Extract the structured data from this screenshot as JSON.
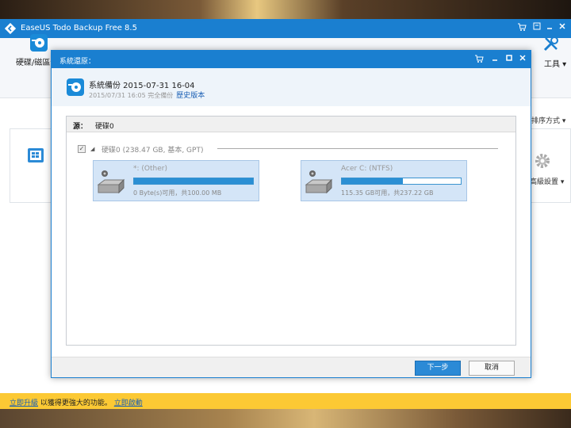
{
  "app": {
    "title": "EaseUS Todo Backup Free 8.5",
    "toolbar": {
      "backup_label": "硬碟/磁區備",
      "tools_label": "工具 ▾"
    },
    "sort_label": "排序方式 ▾",
    "advanced_label": "高級設置 ▾",
    "footer": {
      "upgrade_link": "立即升級",
      "upgrade_text": " 以獲得更強大的功能。 ",
      "activate_link": "立即啟動"
    }
  },
  "dialog": {
    "title": "系統還原：",
    "backup_name": "系統備份 2015-07-31 16-04",
    "backup_info": "2015/07/31 16:05 完全備份",
    "history_link": "歷史版本",
    "source_label": "源：",
    "source_value": "硬碟0",
    "disk_label": "硬碟0 (238.47 GB, 基本, GPT)",
    "partitions": [
      {
        "name": "*: (Other)",
        "usage": "0 Byte(s)可用，共100.00 MB",
        "used_fraction": 1.0
      },
      {
        "name": "Acer C: (NTFS)",
        "usage": "115.35 GB可用，共237.22 GB",
        "used_fraction": 0.51
      }
    ],
    "next_button": "下一步",
    "cancel_button": "取消"
  },
  "colors": {
    "accent": "#1a7fd0",
    "footer_bar": "#fcc934",
    "partition_bg": "#d4e5f7",
    "bar_fill": "#2b8fd4"
  }
}
